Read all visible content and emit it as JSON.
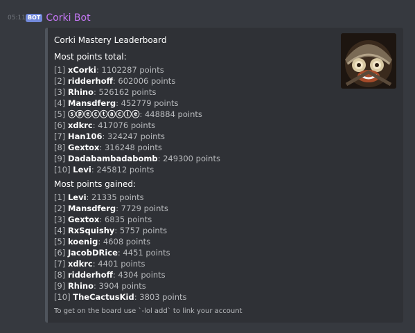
{
  "message": {
    "timestamp": "05:11",
    "bot_tag": "BOT",
    "author": "Corki Bot"
  },
  "embed": {
    "title": "Corki Mastery Leaderboard",
    "thumbnail_icon": "corki-avatar-icon",
    "total": {
      "title": "Most points total:",
      "rows": [
        {
          "rank": "[1]",
          "name": "xCorki",
          "points": ": 1102287 points"
        },
        {
          "rank": "[2]",
          "name": "ridderhoff",
          "points": ": 602006 points"
        },
        {
          "rank": "[3]",
          "name": "Rhino",
          "points": ": 526162 points"
        },
        {
          "rank": "[4]",
          "name": "Mansdferg",
          "points": ": 452779 points"
        },
        {
          "rank": "[5]",
          "name": "ⓢⓟⓔⓒⓣⓐⓒⓛⓔ",
          "points": ": 448884 points"
        },
        {
          "rank": "[6]",
          "name": "xdkrc",
          "points": ": 417076 points"
        },
        {
          "rank": "[7]",
          "name": "Han106",
          "points": ": 324247 points"
        },
        {
          "rank": "[8]",
          "name": "Gextox",
          "points": ": 316248 points"
        },
        {
          "rank": "[9]",
          "name": "Dadabambadabomb",
          "points": ": 249300 points"
        },
        {
          "rank": "[10]",
          "name": "Levi",
          "points": ": 245812 points"
        }
      ]
    },
    "gained": {
      "title": "Most points gained:",
      "rows": [
        {
          "rank": "[1]",
          "name": "Levi",
          "points": ": 21335 points"
        },
        {
          "rank": "[2]",
          "name": "Mansdferg",
          "points": ": 7729 points"
        },
        {
          "rank": "[3]",
          "name": "Gextox",
          "points": ": 6835 points"
        },
        {
          "rank": "[4]",
          "name": "RxSquishy",
          "points": ": 5757 points"
        },
        {
          "rank": "[5]",
          "name": "koenig",
          "points": ": 4608 points"
        },
        {
          "rank": "[6]",
          "name": "JacobDRice",
          "points": ": 4451 points"
        },
        {
          "rank": "[7]",
          "name": "xdkrc",
          "points": ": 4401 points"
        },
        {
          "rank": "[8]",
          "name": "ridderhoff",
          "points": ": 4304 points"
        },
        {
          "rank": "[9]",
          "name": "Rhino",
          "points": ": 3904 points"
        },
        {
          "rank": "[10]",
          "name": "TheCactusKid",
          "points": ": 3803 points"
        }
      ]
    },
    "footer": "To get on the board use `-lol add` to link your account"
  }
}
